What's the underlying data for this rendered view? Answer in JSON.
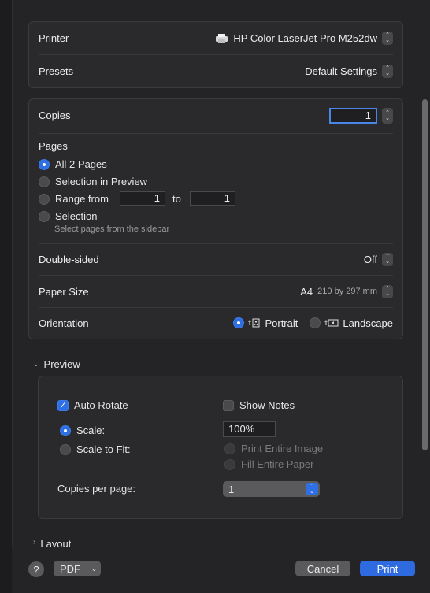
{
  "printer": {
    "label": "Printer",
    "value": "HP Color LaserJet Pro M252dw"
  },
  "presets": {
    "label": "Presets",
    "value": "Default Settings"
  },
  "copies": {
    "label": "Copies",
    "value": "1"
  },
  "pages": {
    "label": "Pages",
    "all": "All 2 Pages",
    "selection_preview": "Selection in Preview",
    "range_from": "Range from",
    "range_start": "1",
    "range_to": "to",
    "range_end": "1",
    "selection": "Selection",
    "selection_hint": "Select pages from the sidebar"
  },
  "double_sided": {
    "label": "Double-sided",
    "value": "Off"
  },
  "paper_size": {
    "label": "Paper Size",
    "value": "A4",
    "dims": "210 by 297 mm"
  },
  "orientation": {
    "label": "Orientation",
    "portrait": "Portrait",
    "landscape": "Landscape"
  },
  "preview": {
    "header": "Preview",
    "auto_rotate": "Auto Rotate",
    "show_notes": "Show Notes",
    "scale": "Scale:",
    "scale_value": "100%",
    "scale_to_fit": "Scale to Fit:",
    "print_entire_image": "Print Entire Image",
    "fill_entire_paper": "Fill Entire Paper",
    "copies_per_page": "Copies per page:",
    "copies_per_page_value": "1"
  },
  "layout_header": "Layout",
  "footer": {
    "help": "?",
    "pdf": "PDF",
    "cancel": "Cancel",
    "print": "Print"
  },
  "colors": {
    "accent": "#2f6fe4",
    "print_button": "#2e6ae0"
  }
}
